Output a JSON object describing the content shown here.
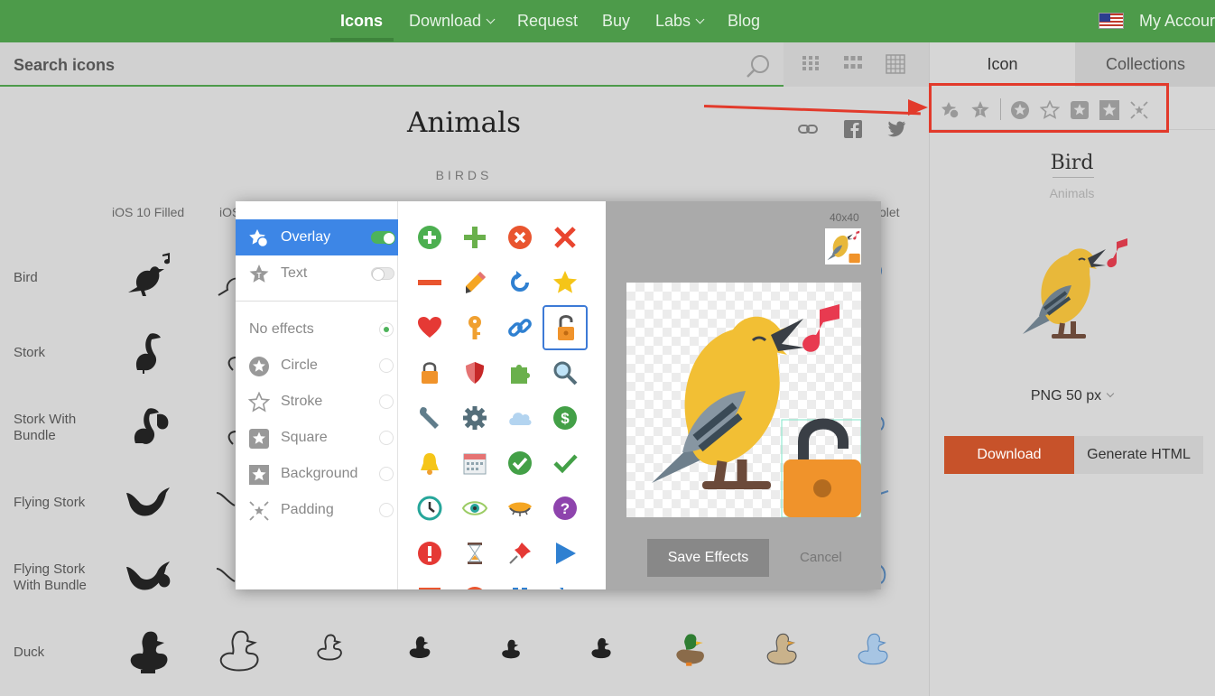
{
  "nav": {
    "items": [
      {
        "label": "Icons"
      },
      {
        "label": "Download"
      },
      {
        "label": "Request"
      },
      {
        "label": "Buy"
      },
      {
        "label": "Labs"
      },
      {
        "label": "Blog"
      }
    ],
    "account": "My Accour"
  },
  "search": {
    "placeholder": "Search icons"
  },
  "page": {
    "title": "Animals",
    "section": "BIRDS",
    "columns": [
      "iOS 10 Filled",
      "iOS",
      "olet"
    ],
    "rows": [
      "Bird",
      "Stork",
      "Stork With\nBundle",
      "Flying Stork",
      "Flying Stork\nWith Bundle",
      "Duck"
    ]
  },
  "right_panel": {
    "tabs": [
      "Icon",
      "Collections"
    ],
    "icon_name": "Bird",
    "icon_category": "Animals",
    "format": "PNG 50 px",
    "download_label": "Download",
    "html_label": "Generate HTML"
  },
  "modal": {
    "effects": [
      {
        "label": "Overlay",
        "selected": true,
        "control": "toggle",
        "on": true
      },
      {
        "label": "Text",
        "control": "toggle",
        "on": false
      },
      {
        "label": "No effects",
        "control": "radio",
        "on": true
      },
      {
        "label": "Circle",
        "control": "radio"
      },
      {
        "label": "Stroke",
        "control": "radio"
      },
      {
        "label": "Square",
        "control": "radio"
      },
      {
        "label": "Background",
        "control": "radio"
      },
      {
        "label": "Padding",
        "control": "radio"
      }
    ],
    "preview_size": "40x40",
    "save_label": "Save Effects",
    "cancel_label": "Cancel"
  },
  "colors": {
    "nav_green": "#4d9b4a",
    "download_orange": "#c7522a",
    "selection_blue": "#3d86e6",
    "annotation_red": "#e23a2b"
  }
}
